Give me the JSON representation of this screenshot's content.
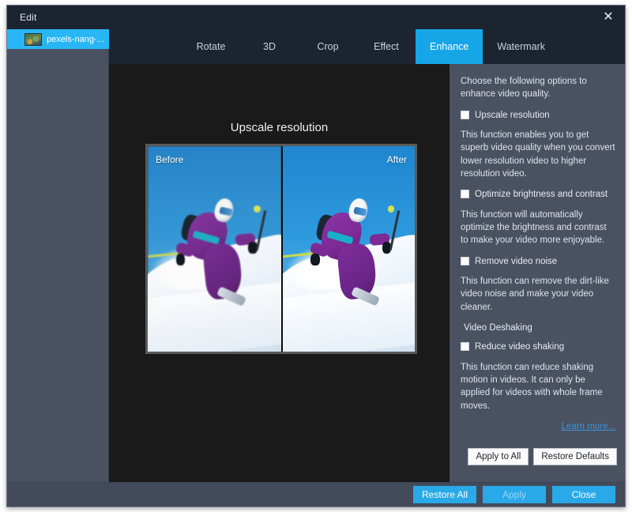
{
  "window": {
    "title": "Edit",
    "close_icon": "close-icon"
  },
  "sidebar": {
    "files": [
      {
        "name": "pexels-nang-...",
        "thumb_icon": "video-thumbnail-icon"
      }
    ]
  },
  "tabs": [
    {
      "label": "Rotate",
      "active": false
    },
    {
      "label": "3D",
      "active": false
    },
    {
      "label": "Crop",
      "active": false
    },
    {
      "label": "Effect",
      "active": false
    },
    {
      "label": "Enhance",
      "active": true
    },
    {
      "label": "Watermark",
      "active": false
    }
  ],
  "preview": {
    "title": "Upscale resolution",
    "before_label": "Before",
    "after_label": "After"
  },
  "options": {
    "intro": "Choose the following options to enhance video quality.",
    "upscale": {
      "label": "Upscale resolution",
      "checked": false,
      "description": "This function enables you to get superb video quality when you convert lower resolution video to higher resolution video."
    },
    "brightness": {
      "label": "Optimize brightness and contrast",
      "checked": false,
      "description": "This function will automatically optimize the brightness and contrast to make your video more enjoyable."
    },
    "noise": {
      "label": "Remove video noise",
      "checked": false,
      "description": "This function can remove the dirt-like video noise and make your video cleaner."
    },
    "deshaking_section": "Video Deshaking",
    "shaking": {
      "label": "Reduce video shaking",
      "checked": false,
      "description": "This function can reduce shaking motion in videos. It can only be applied for videos with whole frame moves."
    },
    "learn_more": "Learn more...",
    "apply_to_all": "Apply to All",
    "restore_defaults": "Restore Defaults"
  },
  "footer": {
    "restore_all": "Restore All",
    "apply": "Apply",
    "close": "Close",
    "apply_enabled": false
  },
  "colors": {
    "accent": "#29a9e8",
    "tab_active": "#16a6e8",
    "panel": "#4a5262",
    "titlebar": "#1c2430",
    "preview_bg": "#1a1a1a",
    "link": "#3b93d8"
  }
}
